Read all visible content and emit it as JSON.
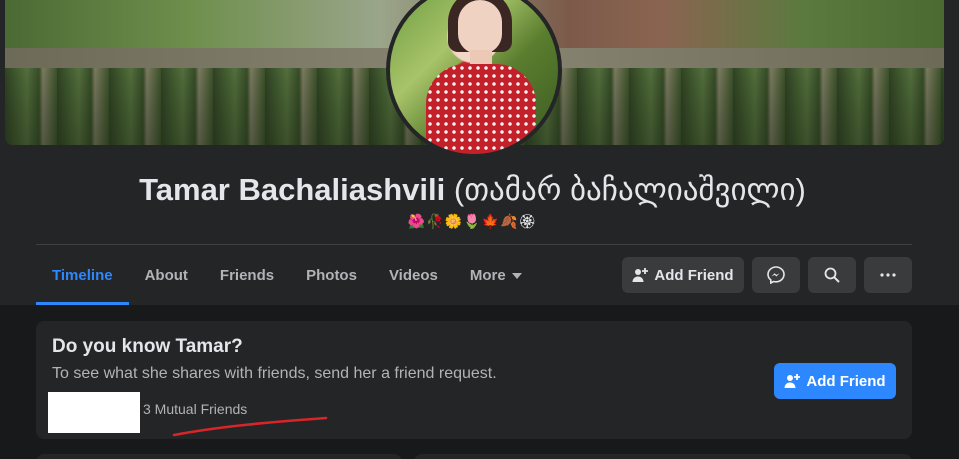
{
  "profile": {
    "name": "Tamar Bachaliashvili",
    "alternate_name": "(თამარ ბაჩალიაშვილი)",
    "bio": "🌺🥀🌼🌷🍁🍂🏵"
  },
  "nav": {
    "tabs": [
      {
        "label": "Timeline",
        "active": true
      },
      {
        "label": "About"
      },
      {
        "label": "Friends"
      },
      {
        "label": "Photos"
      },
      {
        "label": "Videos"
      },
      {
        "label": "More"
      }
    ]
  },
  "actions": {
    "add_friend_label": "Add Friend",
    "icons": [
      "add-friend-icon",
      "messenger-icon",
      "search-icon",
      "more-icon"
    ]
  },
  "know_card": {
    "title": "Do you know Tamar?",
    "subtitle": "To see what she shares with friends, send her a friend request.",
    "mutual_friends": "3 Mutual Friends",
    "button_label": "Add Friend"
  },
  "colors": {
    "accent": "#2d88ff",
    "background": "#18191a",
    "surface": "#242526",
    "button": "#3a3b3c",
    "annotation": "#d8252a"
  }
}
